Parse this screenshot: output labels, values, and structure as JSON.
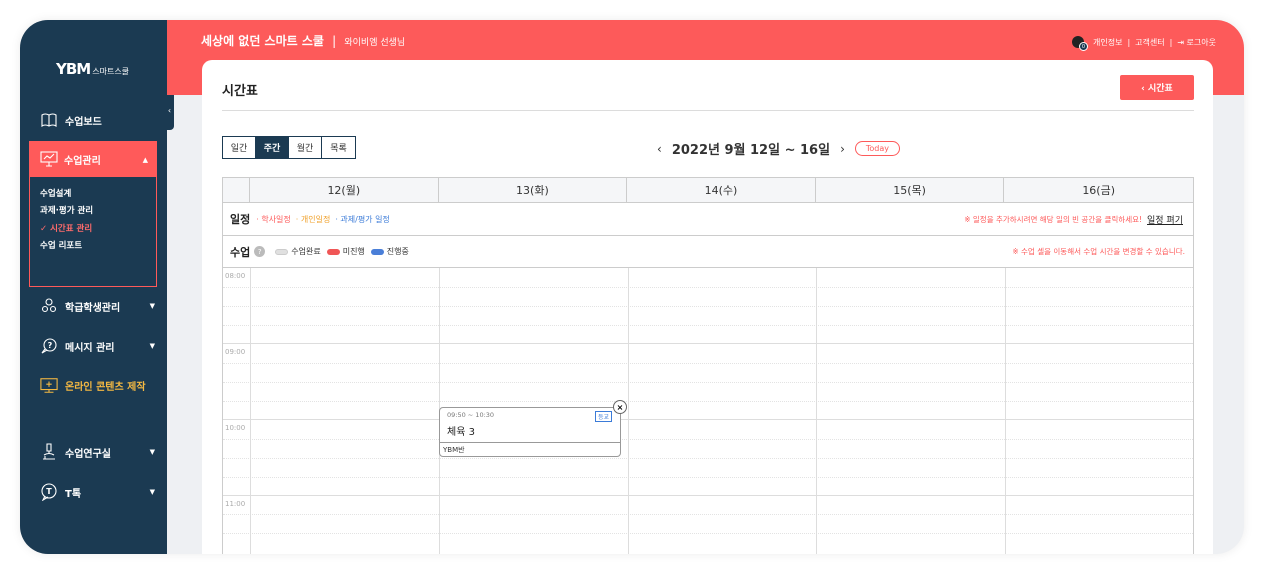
{
  "sidebar": {
    "logo_brand": "YBM",
    "logo_sub": "스마트스쿨",
    "collapse_label": "‹",
    "items": [
      {
        "label": "수업보드",
        "icon": "book-icon"
      },
      {
        "label": "수업관리",
        "icon": "presentation-icon"
      },
      {
        "label": "학급학생관리",
        "icon": "students-icon"
      },
      {
        "label": "메시지 관리",
        "icon": "message-icon"
      },
      {
        "label": "온라인 콘텐츠 제작",
        "icon": "monitor-add-icon"
      },
      {
        "label": "수업연구실",
        "icon": "microscope-icon"
      },
      {
        "label": "T톡",
        "icon": "t-talk-icon"
      }
    ],
    "sub_items": [
      "수업설계",
      "과제·평가 관리",
      "✓ 시간표 관리",
      "수업 리포트"
    ]
  },
  "topbar": {
    "title": "세상에 없던 스마트 스쿨",
    "separator": "|",
    "teacher": "와이비엠 선생님",
    "badge_count": "0",
    "links": [
      "개인정보",
      "|",
      "고객센터",
      "|",
      "⇥ 로그아웃"
    ]
  },
  "page": {
    "title": "시간표",
    "back_label": "‹ 시간표"
  },
  "view_tabs": [
    "일간",
    "주간",
    "월간",
    "목록"
  ],
  "date_nav": {
    "prev": "‹",
    "range": "2022년 9월 12일 ~ 16일",
    "next": "›",
    "today": "Today"
  },
  "days": [
    "12(월)",
    "13(화)",
    "14(수)",
    "15(목)",
    "16(금)"
  ],
  "schedule_row": {
    "label": "일정",
    "legend": [
      "· 학사일정",
      "· 개인일정",
      "· 과제/평가 일정"
    ],
    "hint": "※ 일정을 추가하시려면 해당 일의 빈 공간을 클릭하세요!",
    "fold_link": "일정 펴기"
  },
  "class_row": {
    "label": "수업",
    "help": "?",
    "legend": [
      "수업완료",
      "미진행",
      "진행중"
    ],
    "hint": "※ 수업 셀을 이동해서 수업 시간을 변경할 수 있습니다."
  },
  "time_labels": [
    "08:00",
    "09:00",
    "10:00",
    "11:00"
  ],
  "colors": {
    "accent": "#fd5a5a",
    "sidebar": "#1b3a52",
    "legend_done": "#e0e0e0",
    "legend_pending": "#f05656",
    "legend_progress": "#4a7fd8"
  },
  "event": {
    "time": "09:50 ~ 10:30",
    "tag": "등교",
    "name": "체육 3",
    "class_name": "YBM반",
    "close": "×"
  }
}
